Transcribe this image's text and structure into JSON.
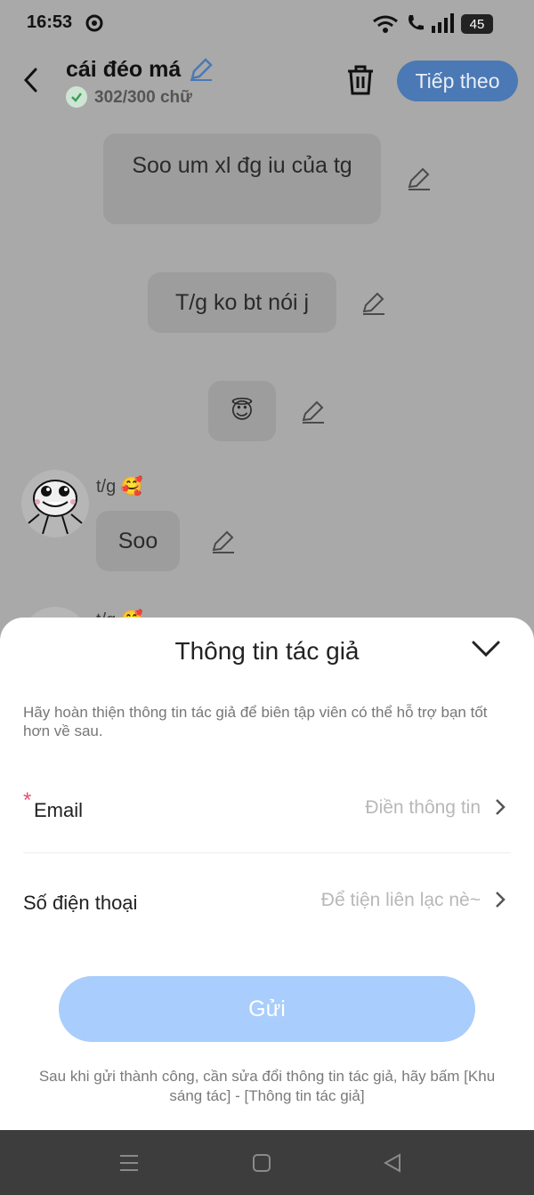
{
  "status_bar": {
    "time": "16:53",
    "battery": "45"
  },
  "header": {
    "title": "cái đéo má",
    "word_count": "302/300 chữ",
    "next_label": "Tiếp theo"
  },
  "messages": [
    {
      "text": "Soo um xl đg iu của tg"
    },
    {
      "text": "T/g ko bt nói j"
    },
    {
      "text": "😇"
    }
  ],
  "author_message": {
    "author": "t/g 🥰",
    "text": "Soo"
  },
  "author_partial": {
    "author": "t/g 🥰"
  },
  "sheet": {
    "title": "Thông tin tác giả",
    "hint": "Hãy hoàn thiện thông tin tác giả để biên tập viên có thể hỗ trợ bạn tốt hơn về sau.",
    "email": {
      "required_mark": "*",
      "label": "Email",
      "placeholder": "Điền thông tin"
    },
    "phone": {
      "label": "Số điện thoại",
      "placeholder": "Để tiện liên lạc nè~"
    },
    "send_label": "Gửi",
    "footnote": "Sau khi gửi thành công, cần sửa đổi thông tin tác giả, hãy bấm [Khu sáng tác] - [Thông tin tác giả]"
  },
  "colors": {
    "accent": "#4a79b5",
    "send_disabled": "#a9cdfc",
    "required": "#e8506a"
  }
}
